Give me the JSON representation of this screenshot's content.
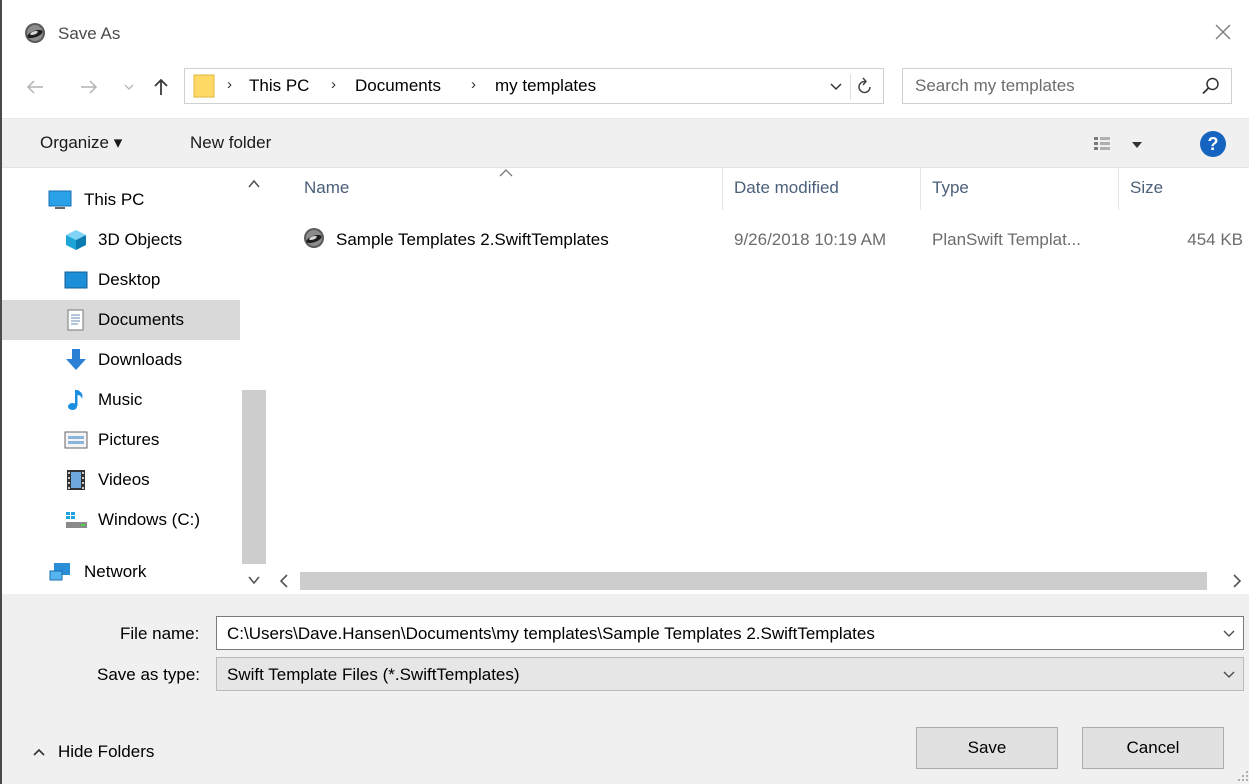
{
  "window": {
    "title": "Save As",
    "close_icon": "close-icon"
  },
  "nav": {
    "back_icon": "arrow-left-icon",
    "forward_icon": "arrow-right-icon",
    "recent_icon": "chevron-down-icon",
    "up_icon": "arrow-up-icon",
    "breadcrumbs": [
      "This PC",
      "Documents",
      "my templates"
    ],
    "refresh_icon": "refresh-icon",
    "search_placeholder": "Search my templates"
  },
  "toolbar": {
    "organize_label": "Organize ▾",
    "new_folder_label": "New folder",
    "help_label": "?"
  },
  "sidebar": {
    "items": [
      {
        "label": "This PC",
        "icon": "computer-icon"
      },
      {
        "label": "3D Objects",
        "icon": "cube-icon"
      },
      {
        "label": "Desktop",
        "icon": "desktop-icon"
      },
      {
        "label": "Documents",
        "icon": "document-icon",
        "selected": true
      },
      {
        "label": "Downloads",
        "icon": "download-arrow-icon"
      },
      {
        "label": "Music",
        "icon": "music-note-icon"
      },
      {
        "label": "Pictures",
        "icon": "picture-icon"
      },
      {
        "label": "Videos",
        "icon": "film-icon"
      },
      {
        "label": "Windows (C:)",
        "icon": "drive-icon"
      },
      {
        "label": "Network",
        "icon": "network-icon"
      }
    ]
  },
  "file_list": {
    "columns": [
      "Name",
      "Date modified",
      "Type",
      "Size"
    ],
    "rows": [
      {
        "name": "Sample Templates 2.SwiftTemplates",
        "date_modified": "9/26/2018 10:19 AM",
        "type": "PlanSwift Templat...",
        "size": "454 KB"
      }
    ]
  },
  "form": {
    "file_name_label": "File name:",
    "file_name_value": "C:\\Users\\Dave.Hansen\\Documents\\my templates\\Sample Templates 2.SwiftTemplates",
    "save_as_type_label": "Save as type:",
    "save_as_type_value": "Swift Template Files (*.SwiftTemplates)"
  },
  "footer": {
    "hide_folders_label": "Hide Folders",
    "save_label": "Save",
    "cancel_label": "Cancel"
  },
  "colors": {
    "selected_row": "#d9d9d9",
    "toolbar_bg": "#f0f0f0",
    "help_blue": "#1565c0",
    "column_header": "#4c607a"
  }
}
